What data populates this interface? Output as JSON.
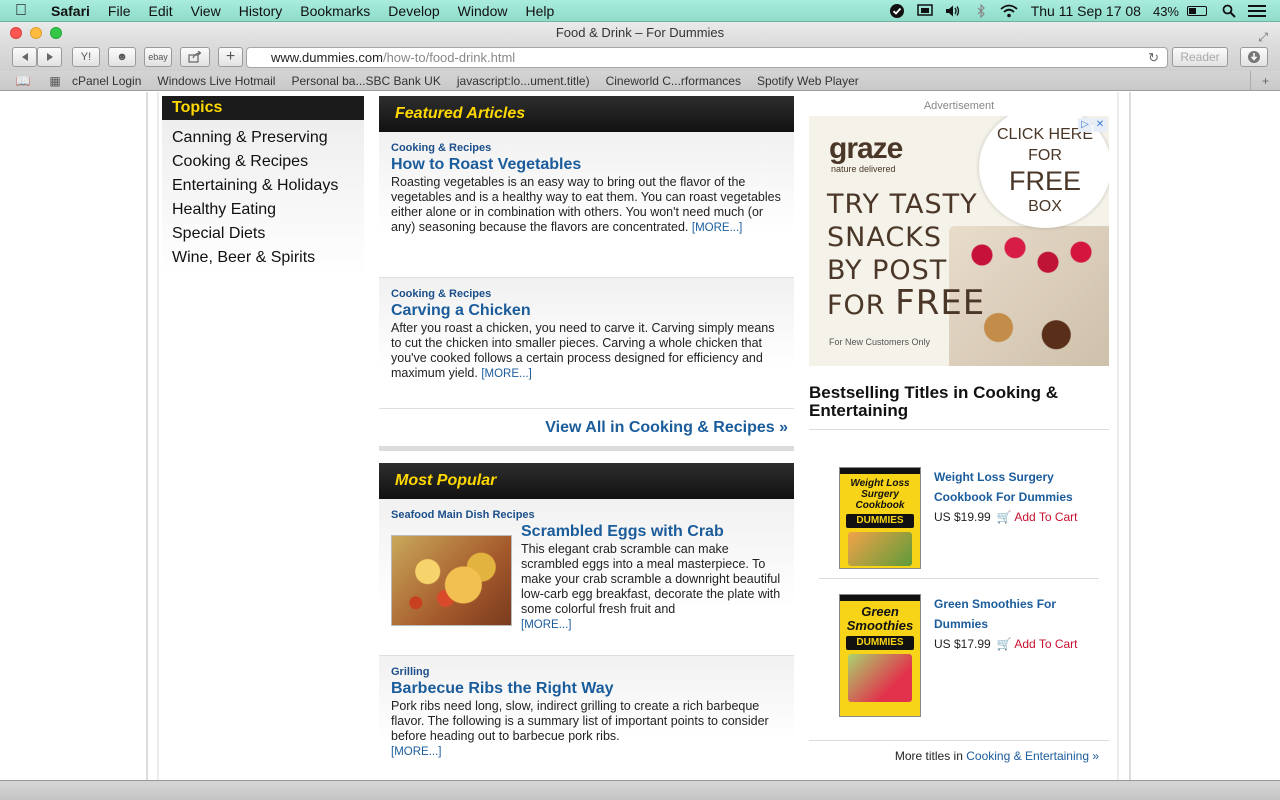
{
  "menubar": {
    "app": "Safari",
    "items": [
      "File",
      "Edit",
      "View",
      "History",
      "Bookmarks",
      "Develop",
      "Window",
      "Help"
    ],
    "clock": "Thu 11 Sep  17 08",
    "battery": "43%"
  },
  "browser": {
    "window_title": "Food & Drink – For Dummies",
    "url_domain": "www.dummies.com",
    "url_path": "/how-to/food-drink.html",
    "reader_label": "Reader",
    "toolbar_labels": {
      "yelp": "Y!",
      "ebay": "ebay",
      "new_tab": "+"
    },
    "bookmarks": [
      "cPanel Login",
      "Windows Live Hotmail",
      "Personal ba...SBC Bank UK",
      "javascript:lo...ument.title)",
      "Cineworld C...rformances",
      "Spotify Web Player"
    ]
  },
  "topics": {
    "heading": "Topics",
    "items": [
      "Canning & Preserving",
      "Cooking & Recipes",
      "Entertaining & Holidays",
      "Healthy Eating",
      "Special Diets",
      "Wine, Beer & Spirits"
    ]
  },
  "featured": {
    "heading": "Featured Articles",
    "articles": [
      {
        "category": "Cooking & Recipes",
        "title": "How to Roast Vegetables",
        "body": "Roasting vegetables is an easy way to bring out the flavor of the vegetables and is a healthy way to eat them. You can roast vegetables either alone or in combination with others. You won't need much (or any) seasoning because the flavors are concentrated.",
        "more": "[MORE...]"
      },
      {
        "category": "Cooking & Recipes",
        "title": "Carving a Chicken",
        "body": "After you roast a chicken, you need to carve it. Carving simply means to cut the chicken into smaller pieces. Carving a whole chicken that you've cooked follows a certain process designed for efficiency and maximum yield.",
        "more": "[MORE...]"
      }
    ],
    "view_all": "View All in Cooking & Recipes »"
  },
  "popular": {
    "heading": "Most Popular",
    "articles": [
      {
        "category": "Seafood Main Dish Recipes",
        "title": "Scrambled Eggs with Crab",
        "body": "This elegant crab scramble can make scrambled eggs into a meal masterpiece. To make your crab scramble a downright beautiful low-carb egg breakfast, decorate the plate with some colorful fresh fruit and",
        "more": "[MORE...]"
      },
      {
        "category": "Grilling",
        "title": "Barbecue Ribs the Right Way",
        "body": "Pork ribs need long, slow, indirect grilling to create a rich barbeque flavor. The following is a summary list of important points to consider before heading out to barbecue pork ribs.",
        "more": "[MORE...]"
      }
    ]
  },
  "ad": {
    "label": "Advertisement",
    "logo": "graze",
    "logo_sub": "nature delivered",
    "headline_1": "TRY TASTY",
    "headline_2": "SNACKS",
    "headline_3": "BY POST",
    "headline_4": "FOR",
    "headline_free": "FREE",
    "circle_1": "CLICK HERE FOR",
    "circle_2": "FREE",
    "circle_3": "BOX",
    "fine_print": "For New Customers Only"
  },
  "bestsellers": {
    "heading": "Bestselling Titles in Cooking & Entertaining",
    "books": [
      {
        "title": "Weight Loss Surgery Cookbook For Dummies",
        "cover_title": "Weight Loss Surgery Cookbook",
        "price": "US $19.99",
        "cart": "Add To Cart"
      },
      {
        "title": "Green Smoothies For Dummies",
        "cover_title": "Green Smoothies",
        "price": "US $17.99",
        "cart": "Add To Cart"
      }
    ],
    "cover_brand": "DUMMIES",
    "more_prefix": "More titles in",
    "more_link": "Cooking & Entertaining »"
  }
}
